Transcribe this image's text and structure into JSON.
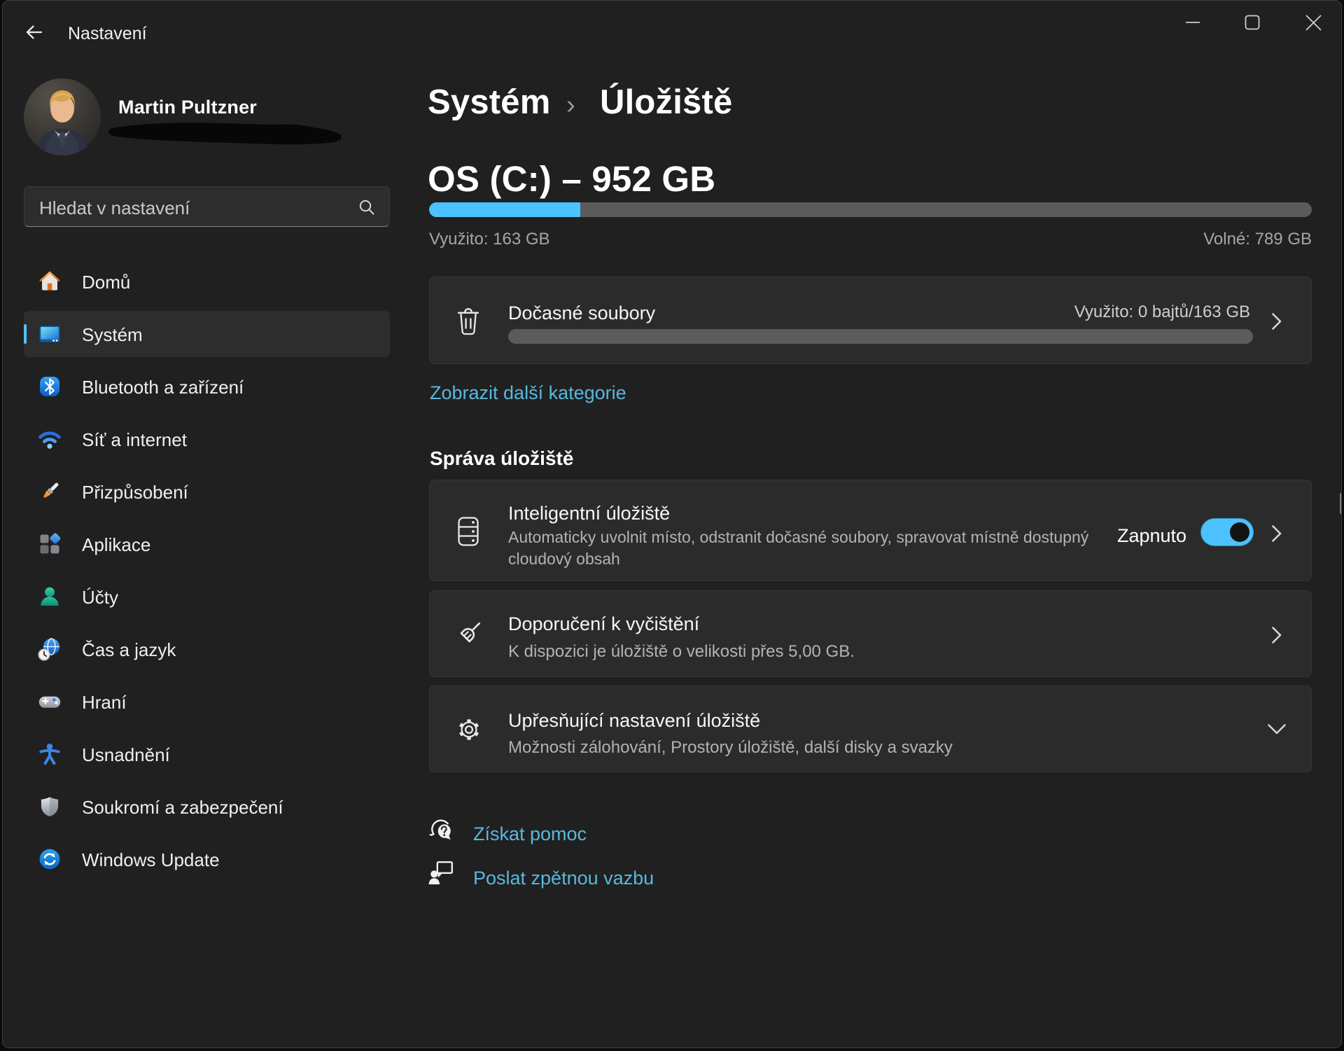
{
  "window": {
    "title": "Nastavení"
  },
  "accent_color": "#4cc2ff",
  "link_color": "#58b8dd",
  "user": {
    "name": "Martin Pultzner",
    "email_redacted": true
  },
  "search": {
    "placeholder": "Hledat v nastavení"
  },
  "sidebar": {
    "items": [
      {
        "label": "Domů",
        "icon": "home-icon",
        "selected": false
      },
      {
        "label": "Systém",
        "icon": "system-icon",
        "selected": true
      },
      {
        "label": "Bluetooth a zařízení",
        "icon": "bluetooth-icon",
        "selected": false
      },
      {
        "label": "Síť a internet",
        "icon": "network-icon",
        "selected": false
      },
      {
        "label": "Přizpůsobení",
        "icon": "personalization-icon",
        "selected": false
      },
      {
        "label": "Aplikace",
        "icon": "apps-icon",
        "selected": false
      },
      {
        "label": "Účty",
        "icon": "accounts-icon",
        "selected": false
      },
      {
        "label": "Čas a jazyk",
        "icon": "time-language-icon",
        "selected": false
      },
      {
        "label": "Hraní",
        "icon": "gaming-icon",
        "selected": false
      },
      {
        "label": "Usnadnění",
        "icon": "accessibility-icon",
        "selected": false
      },
      {
        "label": "Soukromí a zabezpečení",
        "icon": "privacy-icon",
        "selected": false
      },
      {
        "label": "Windows Update",
        "icon": "windows-update-icon",
        "selected": false
      }
    ]
  },
  "breadcrumb": {
    "parent": "Systém",
    "separator": "›",
    "current": "Úložiště"
  },
  "drive": {
    "title": "OS (C:) – 952 GB",
    "used_label": "Využito: 163 GB",
    "free_label": "Volné: 789 GB",
    "used_percent": 17.1
  },
  "temp_files": {
    "title": "Dočasné soubory",
    "usage_label": "Využito: 0 bajtů/163 GB",
    "used_percent": 0
  },
  "show_more_label": "Zobrazit další kategorie",
  "section_title": "Správa úložiště",
  "cards": {
    "storage_sense": {
      "title": "Inteligentní úložiště",
      "description": "Automaticky uvolnit místo, odstranit dočasné soubory, spravovat místně dostupný cloudový obsah",
      "toggle_label": "Zapnuto",
      "toggle_on": true
    },
    "cleanup": {
      "title": "Doporučení k vyčištění",
      "description": "K dispozici je úložiště o velikosti přes 5,00 GB."
    },
    "advanced": {
      "title": "Upřesňující nastavení úložiště",
      "description": "Možnosti zálohování, Prostory úložiště, další disky a svazky"
    }
  },
  "footer_links": {
    "help": "Získat pomoc",
    "feedback": "Poslat zpětnou vazbu"
  }
}
